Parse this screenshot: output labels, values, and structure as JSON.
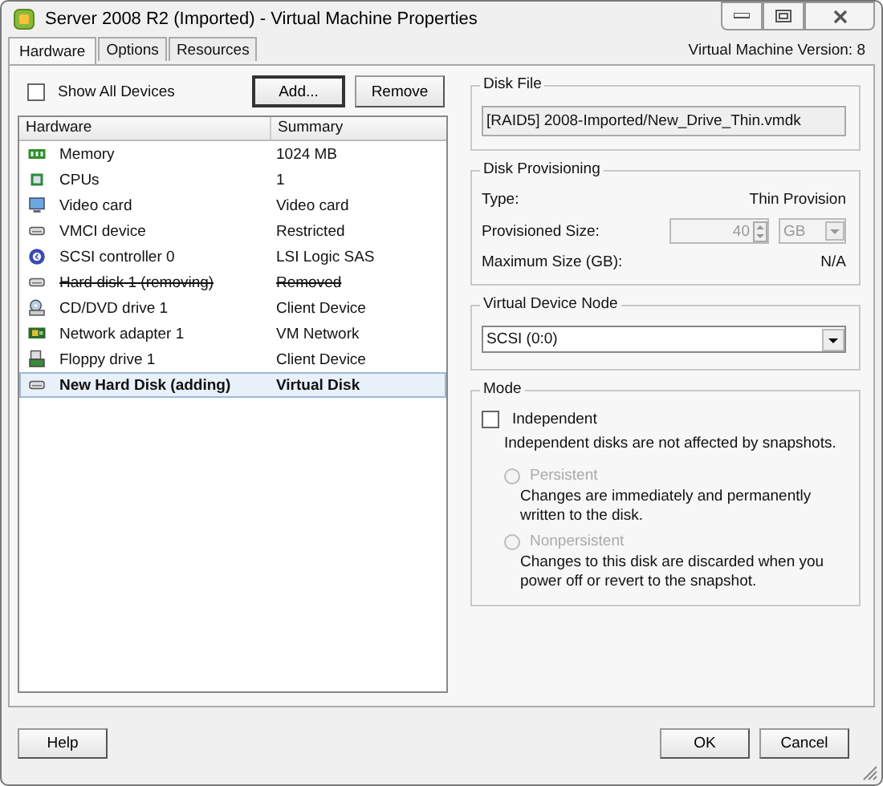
{
  "window": {
    "title": "Server 2008 R2 (Imported) - Virtual Machine Properties"
  },
  "tabs": [
    {
      "label": "Hardware",
      "selected": true
    },
    {
      "label": "Options",
      "selected": false
    },
    {
      "label": "Resources",
      "selected": false
    }
  ],
  "version": "Virtual Machine Version: 8",
  "show_all_devices": {
    "label": "Show All Devices",
    "checked": false
  },
  "device_buttons": [
    "Add...",
    "Remove"
  ],
  "hardware_table": {
    "columns": [
      "Hardware",
      "Summary"
    ],
    "rows": [
      {
        "kind": "memory",
        "name": "Memory",
        "summary": "1024 MB",
        "removing": false,
        "adding": false,
        "selected": false
      },
      {
        "kind": "cpu",
        "name": "CPUs",
        "summary": "1",
        "removing": false,
        "adding": false,
        "selected": false
      },
      {
        "kind": "monitor",
        "name": "Video card",
        "summary": "Video card",
        "removing": false,
        "adding": false,
        "selected": false
      },
      {
        "kind": "disk",
        "name": "VMCI device",
        "summary": "Restricted",
        "removing": false,
        "adding": false,
        "selected": false
      },
      {
        "kind": "controller",
        "name": "SCSI controller 0",
        "summary": "LSI Logic SAS",
        "removing": false,
        "adding": false,
        "selected": false
      },
      {
        "kind": "disk",
        "name": "Hard disk 1 (removing)",
        "summary": "Removed",
        "removing": true,
        "adding": false,
        "selected": false
      },
      {
        "kind": "cdrom",
        "name": "CD/DVD drive 1",
        "summary": "Client Device",
        "removing": false,
        "adding": false,
        "selected": false
      },
      {
        "kind": "network",
        "name": "Network adapter 1",
        "summary": "VM Network",
        "removing": false,
        "adding": false,
        "selected": false
      },
      {
        "kind": "floppy",
        "name": "Floppy drive 1",
        "summary": "Client Device",
        "removing": false,
        "adding": false,
        "selected": false
      },
      {
        "kind": "disk",
        "name": "New Hard Disk (adding)",
        "summary": "Virtual Disk",
        "removing": false,
        "adding": true,
        "selected": true
      }
    ]
  },
  "disk_file": {
    "title": "Disk File",
    "value": "[RAID5] 2008-Imported/New_Drive_Thin.vmdk"
  },
  "disk_provisioning": {
    "title": "Disk Provisioning",
    "type_label": "Type:",
    "type_value": "Thin Provision",
    "size_label": "Provisioned Size:",
    "size_value": "40",
    "size_unit": "GB",
    "size_disabled": true,
    "max_label": "Maximum Size (GB):",
    "max_value": "N/A"
  },
  "virtual_device_node": {
    "title": "Virtual Device Node",
    "value": "SCSI (0:0)"
  },
  "mode": {
    "title": "Mode",
    "independent": {
      "label": "Independent",
      "checked": false
    },
    "independent_note": "Independent disks are not affected by snapshots.",
    "options": [
      {
        "label": "Persistent",
        "note": "Changes are immediately and permanently written to the disk.",
        "selected": false,
        "disabled": true
      },
      {
        "label": "Nonpersistent",
        "note": "Changes to this disk are discarded when you power off or revert to the snapshot.",
        "selected": false,
        "disabled": true
      }
    ]
  },
  "footer_buttons": {
    "left": [
      "Help"
    ],
    "right": [
      "OK",
      "Cancel"
    ]
  }
}
